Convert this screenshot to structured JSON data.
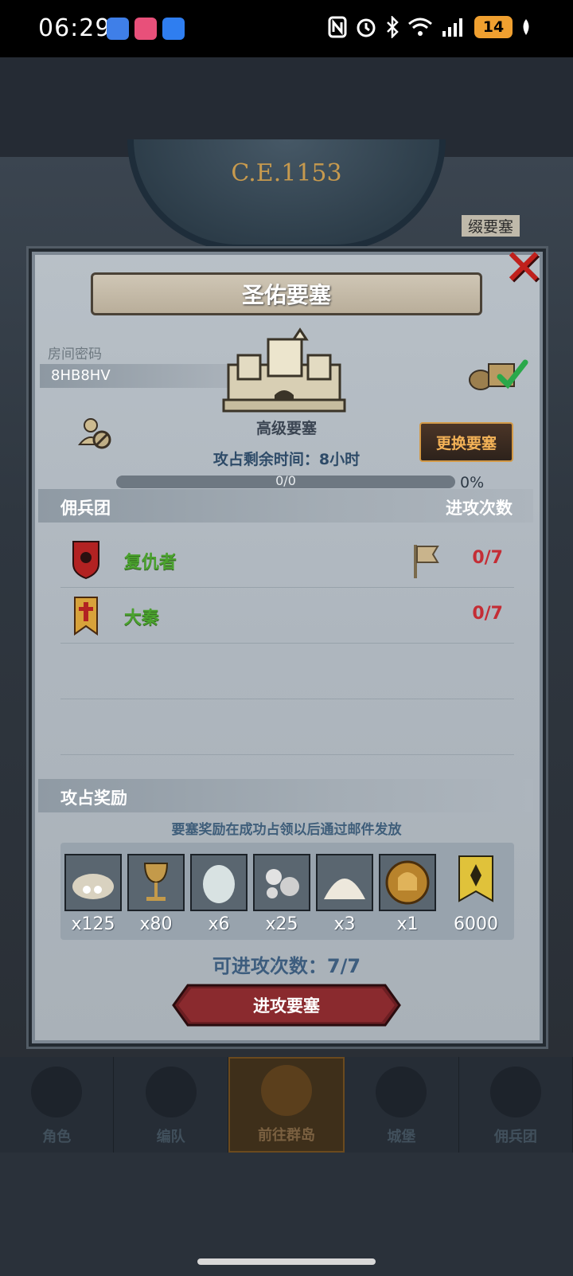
{
  "status_bar": {
    "time": "06:29",
    "battery": "14"
  },
  "background": {
    "era_label": "C.E.1153",
    "side_label": "缀要塞"
  },
  "modal": {
    "title": "圣佑要塞",
    "room_code_label": "房间密码",
    "room_code": "8HB8HV",
    "fortress_type": "高级要塞",
    "change_button": "更换要塞",
    "time_remaining": "攻占剩余时间：8小时",
    "progress": {
      "text": "0/0",
      "percent_label": "0%",
      "value": 0
    },
    "mercenary_header": "佣兵团",
    "attack_count_header": "进攻次数",
    "mercenaries": [
      {
        "name": "复仇者",
        "count": "0/7",
        "has_flag": true
      },
      {
        "name": "大秦",
        "count": "0/7",
        "has_flag": false
      }
    ],
    "reward_header": "攻占奖励",
    "reward_note": "要塞奖励在成功占领以后通过邮件发放",
    "rewards": [
      {
        "icon": "silver-sack-icon",
        "qty": "x125"
      },
      {
        "icon": "goblet-icon",
        "qty": "x80"
      },
      {
        "icon": "stone-egg-icon",
        "qty": "x6"
      },
      {
        "icon": "silver-ore-icon",
        "qty": "x25"
      },
      {
        "icon": "salt-pile-icon",
        "qty": "x3"
      },
      {
        "icon": "knight-medal-icon",
        "qty": "x1"
      },
      {
        "icon": "guild-banner-icon",
        "qty": "6000"
      }
    ],
    "attacks_available": "可进攻次数：7/7",
    "attack_button": "进攻要塞"
  },
  "bottom_nav": [
    {
      "label": "角色",
      "active": false
    },
    {
      "label": "编队",
      "active": false
    },
    {
      "label": "前往群岛",
      "active": true
    },
    {
      "label": "城堡",
      "active": false
    },
    {
      "label": "佣兵团",
      "active": false
    }
  ],
  "colors": {
    "accent_gold": "#f3b257",
    "merc_name_green": "#4aa22e",
    "count_red": "#c42d35",
    "close_red": "#c0201c"
  }
}
